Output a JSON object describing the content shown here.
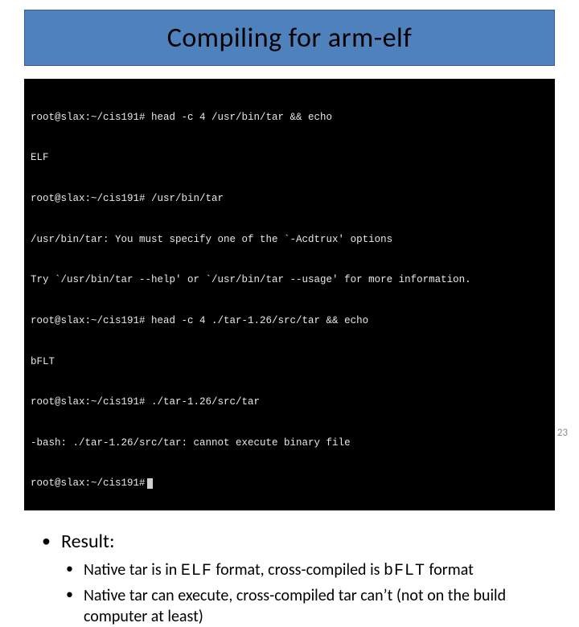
{
  "title": "Compiling for arm-elf",
  "terminal": {
    "lines": [
      "root@slax:~/cis191# head -c 4 /usr/bin/tar && echo",
      "ELF",
      "root@slax:~/cis191# /usr/bin/tar",
      "/usr/bin/tar: You must specify one of the `-Acdtrux' options",
      "Try `/usr/bin/tar --help' or `/usr/bin/tar --usage' for more information.",
      "root@slax:~/cis191# head -c 4 ./tar-1.26/src/tar && echo",
      "bFLT",
      "root@slax:~/cis191# ./tar-1.26/src/tar",
      "-bash: ./tar-1.26/src/tar: cannot execute binary file",
      "root@slax:~/cis191#"
    ]
  },
  "body": {
    "result_label": "Result:",
    "sub1_pre": "Native tar is in ",
    "sub1_code1": "ELF",
    "sub1_mid": " format, cross-compiled is ",
    "sub1_code2": "bFLT",
    "sub1_post": " format",
    "sub2": "Native tar can execute, cross-compiled tar can’t (not on the build computer at least)"
  },
  "page_number": "23"
}
